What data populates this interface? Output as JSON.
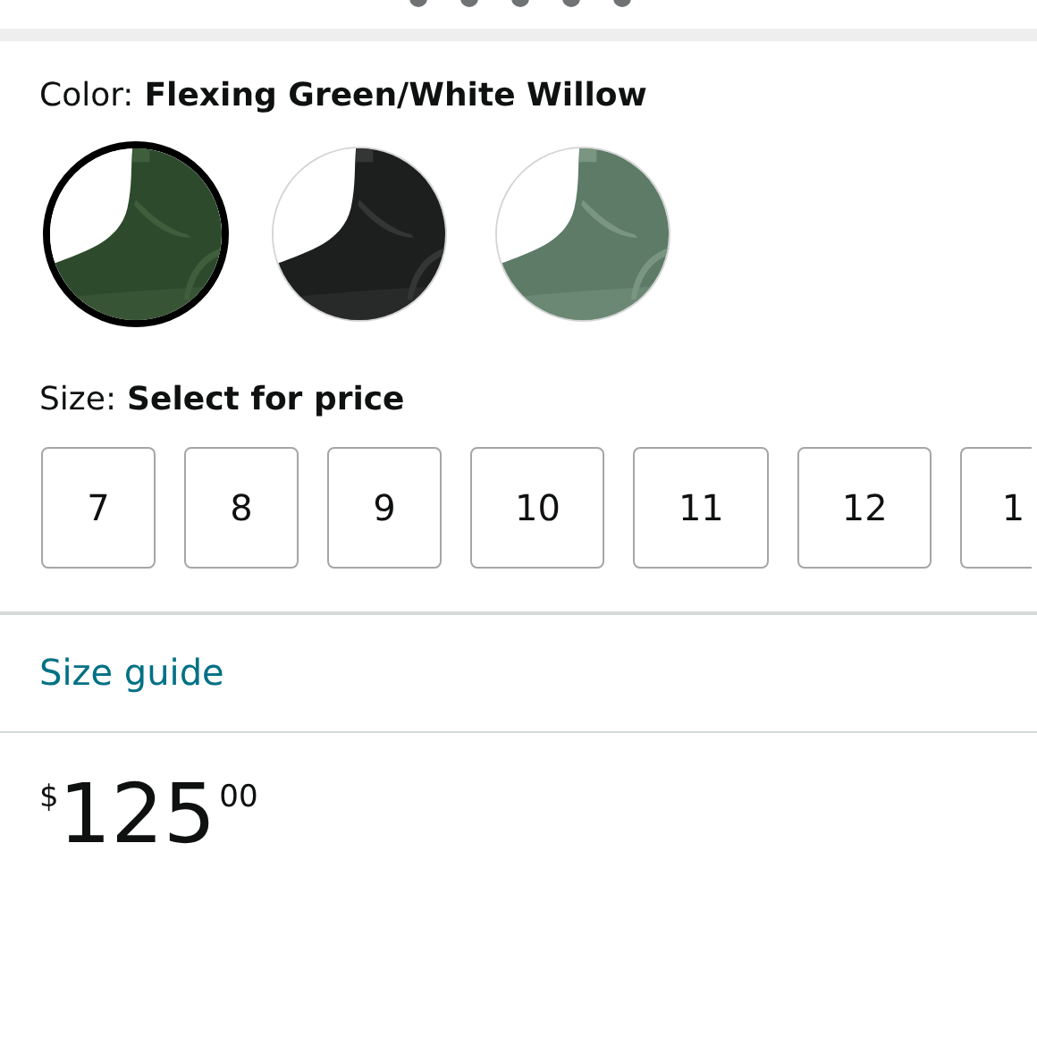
{
  "color": {
    "label": "Color:",
    "value": "Flexing Green/White Willow",
    "swatches": [
      {
        "kind": "picture",
        "selected": true
      },
      {
        "kind": "picture",
        "selected": false
      },
      {
        "kind": "picture",
        "selected": false
      }
    ]
  },
  "size": {
    "label": "Size:",
    "value": "Select for price",
    "options": [
      {
        "label": "7",
        "selected": false
      },
      {
        "label": "8",
        "selected": false
      },
      {
        "label": "9",
        "selected": false
      },
      {
        "label": "10",
        "selected": false
      },
      {
        "label": "11",
        "selected": false
      },
      {
        "label": "12",
        "selected": false
      },
      {
        "label": "1",
        "selected": false
      }
    ]
  },
  "size_guide": "Size guide",
  "price": {
    "symbol": "$",
    "whole": "125",
    "fraction": "00"
  }
}
